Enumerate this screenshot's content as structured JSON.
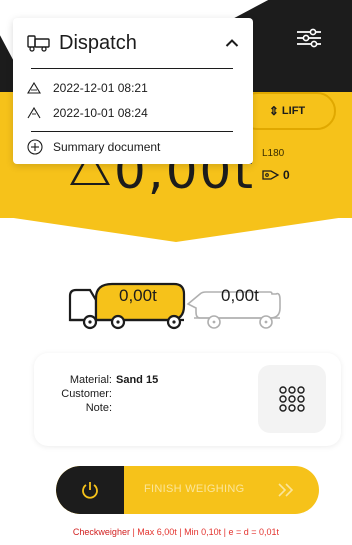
{
  "dispatch": {
    "title": "Dispatch",
    "items": [
      {
        "datetime": "2022-12-01 08:21"
      },
      {
        "datetime": "2022-10-01 08:24"
      }
    ],
    "summary_label": "Summary document"
  },
  "scale": {
    "lift_label": "LIFT",
    "axle_label": "L180",
    "tag_count": "0",
    "main_weight": "0,00t"
  },
  "truck": {
    "cab_weight": "0,00t",
    "trailer_weight": "0,00t"
  },
  "load_info": {
    "material_label": "Material:",
    "material_value": "Sand 15",
    "customer_label": "Customer:",
    "customer_value": "",
    "note_label": "Note:",
    "note_value": ""
  },
  "actions": {
    "finish_label": "FINISH WEIGHING"
  },
  "status": {
    "name": "Checkweigher",
    "details": " | Max 6,00t | Min 0,10t | e = d = 0,01t"
  },
  "colors": {
    "accent": "#f6c21a",
    "dark": "#1c1c1c",
    "alert": "#e3342f"
  }
}
